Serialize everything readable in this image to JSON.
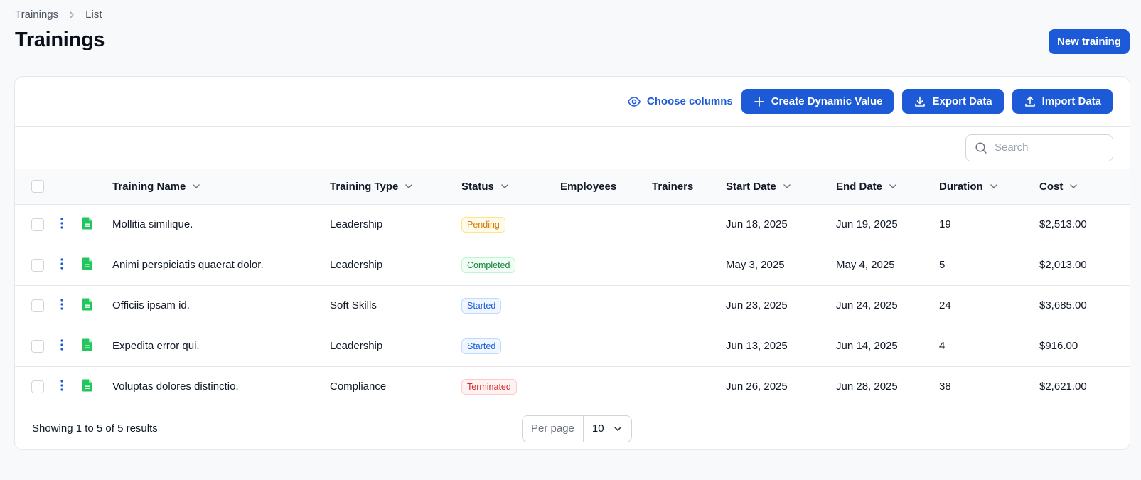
{
  "breadcrumb": {
    "items": [
      "Trainings",
      "List"
    ]
  },
  "page": {
    "title": "Trainings",
    "new_button": "New training"
  },
  "toolbar": {
    "choose_columns": "Choose columns",
    "create_dynamic_value": "Create Dynamic Value",
    "export_data": "Export Data",
    "import_data": "Import Data"
  },
  "search": {
    "placeholder": "Search"
  },
  "table": {
    "headers": {
      "name": "Training Name",
      "type": "Training Type",
      "status": "Status",
      "employees": "Employees",
      "trainers": "Trainers",
      "start_date": "Start Date",
      "end_date": "End Date",
      "duration": "Duration",
      "cost": "Cost"
    },
    "rows": [
      {
        "name": "Mollitia similique.",
        "type": "Leadership",
        "status": "Pending",
        "status_color": "#d97706",
        "start_date": "Jun 18, 2025",
        "end_date": "Jun 19, 2025",
        "duration": "19",
        "cost": "$2,513.00"
      },
      {
        "name": "Animi perspiciatis quaerat dolor.",
        "type": "Leadership",
        "status": "Completed",
        "status_color": "#15803d",
        "start_date": "May 3, 2025",
        "end_date": "May 4, 2025",
        "duration": "5",
        "cost": "$2,013.00"
      },
      {
        "name": "Officiis ipsam id.",
        "type": "Soft Skills",
        "status": "Started",
        "status_color": "#1d5ad8",
        "start_date": "Jun 23, 2025",
        "end_date": "Jun 24, 2025",
        "duration": "24",
        "cost": "$3,685.00"
      },
      {
        "name": "Expedita error qui.",
        "type": "Leadership",
        "status": "Started",
        "status_color": "#1d5ad8",
        "start_date": "Jun 13, 2025",
        "end_date": "Jun 14, 2025",
        "duration": "4",
        "cost": "$916.00"
      },
      {
        "name": "Voluptas dolores distinctio.",
        "type": "Compliance",
        "status": "Terminated",
        "status_color": "#dc2626",
        "start_date": "Jun 26, 2025",
        "end_date": "Jun 28, 2025",
        "duration": "38",
        "cost": "$2,621.00"
      }
    ]
  },
  "footer": {
    "results_text": "Showing 1 to 5 of 5 results",
    "per_page_label": "Per page",
    "per_page_value": "10"
  },
  "colors": {
    "primary": "#1d5ad8",
    "file_icon": "#22c55e"
  }
}
